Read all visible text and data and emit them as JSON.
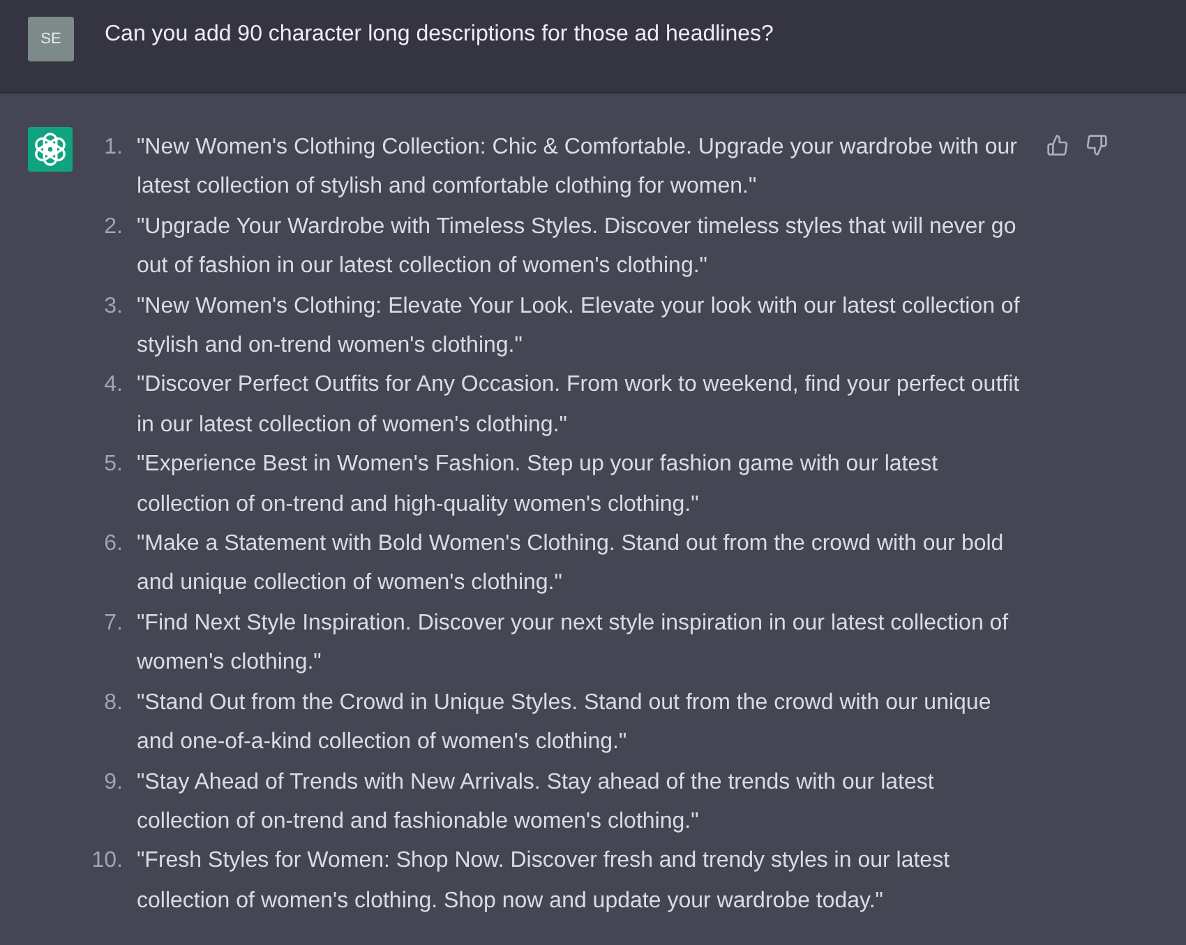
{
  "user_message": {
    "avatar_initials": "SE",
    "text": "Can you add 90 character long descriptions for those ad headlines?"
  },
  "assistant_message": {
    "items": [
      {
        "number": "1.",
        "text": "\"New Women's Clothing Collection: Chic & Comfortable. Upgrade your wardrobe with our latest collection of stylish and comfortable clothing for women.\""
      },
      {
        "number": "2.",
        "text": "\"Upgrade Your Wardrobe with Timeless Styles. Discover timeless styles that will never go out of fashion in our latest collection of women's clothing.\""
      },
      {
        "number": "3.",
        "text": "\"New Women's Clothing: Elevate Your Look. Elevate your look with our latest collection of stylish and on-trend women's clothing.\""
      },
      {
        "number": "4.",
        "text": "\"Discover Perfect Outfits for Any Occasion. From work to weekend, find your perfect outfit in our latest collection of women's clothing.\""
      },
      {
        "number": "5.",
        "text": "\"Experience Best in Women's Fashion. Step up your fashion game with our latest collection of on-trend and high-quality women's clothing.\""
      },
      {
        "number": "6.",
        "text": "\"Make a Statement with Bold Women's Clothing. Stand out from the crowd with our bold and unique collection of women's clothing.\""
      },
      {
        "number": "7.",
        "text": "\"Find Next Style Inspiration. Discover your next style inspiration in our latest collection of women's clothing.\""
      },
      {
        "number": "8.",
        "text": "\"Stand Out from the Crowd in Unique Styles. Stand out from the crowd with our unique and one-of-a-kind collection of women's clothing.\""
      },
      {
        "number": "9.",
        "text": "\"Stay Ahead of Trends with New Arrivals. Stay ahead of the trends with our latest collection of on-trend and fashionable women's clothing.\""
      },
      {
        "number": "10.",
        "text": "\"Fresh Styles for Women: Shop Now. Discover fresh and trendy styles in our latest collection of women's clothing. Shop now and update your wardrobe today.\""
      }
    ]
  }
}
